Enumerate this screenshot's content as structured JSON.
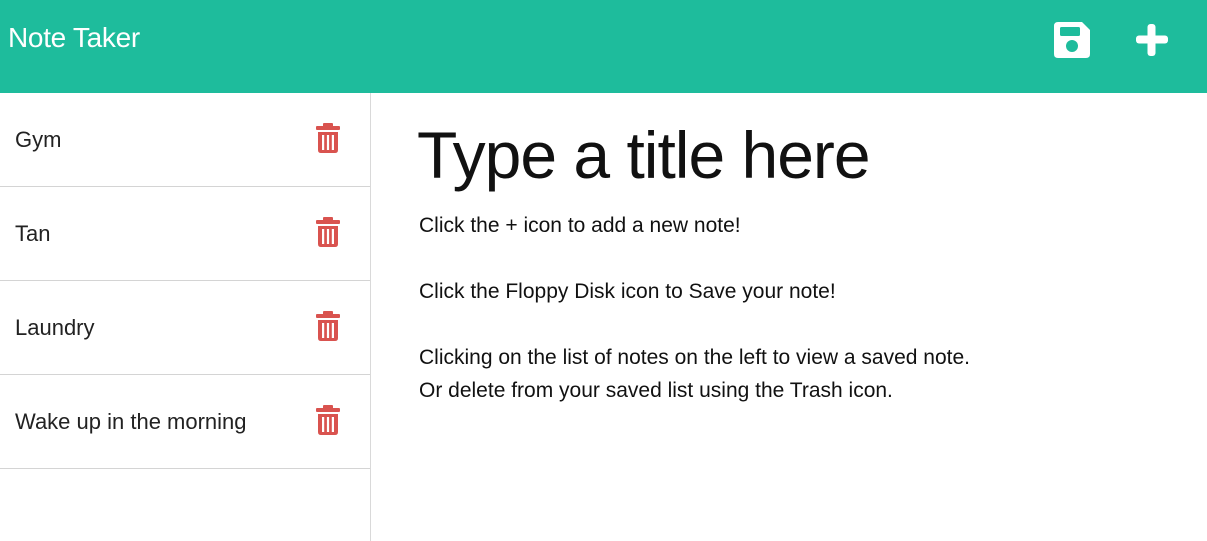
{
  "app": {
    "title": "Note Taker"
  },
  "colors": {
    "navbar": "#1ebc9c",
    "trash": "#d9534f",
    "icon": "#ffffff"
  },
  "toolbar": {
    "save_icon": "floppy-disk-icon",
    "new_icon": "plus-icon"
  },
  "notes": [
    {
      "title": "Gym"
    },
    {
      "title": "Tan"
    },
    {
      "title": "Laundry"
    },
    {
      "title": "Wake up in the morning"
    }
  ],
  "editor": {
    "title_placeholder": "Type a title here",
    "body_placeholder": "Click the + icon to add a new note!\n\nClick the Floppy Disk icon to Save your note!\n\nClicking on the list of notes on the left to view a saved note.\nOr delete from your saved list using the Trash icon."
  }
}
